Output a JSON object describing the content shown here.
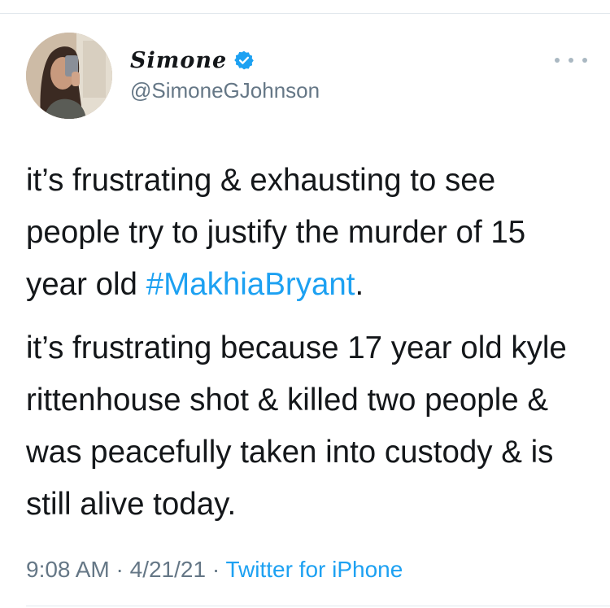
{
  "tweet": {
    "author": {
      "display_name": "Simone",
      "handle": "@SimoneGJohnson",
      "verified": true
    },
    "body": {
      "paragraph1_before": "it’s frustrating & exhausting to see people try to justify the murder of 15 year old ",
      "hashtag": "#MakhiaBryant",
      "paragraph1_after": ".",
      "paragraph2": "it’s frustrating because 17 year old kyle rittenhouse shot & killed two people & was peacefully taken into custody & is still alive today."
    },
    "time": "9:08 AM",
    "separator1": " · ",
    "date": "4/21/21",
    "separator2": " · ",
    "source": "Twitter for iPhone"
  },
  "icons": {
    "verified": "verified-badge-icon",
    "more": "more-options-icon"
  },
  "colors": {
    "link": "#1da1f2",
    "muted": "#657786",
    "text": "#14171a",
    "divider": "#e1e8ed"
  }
}
